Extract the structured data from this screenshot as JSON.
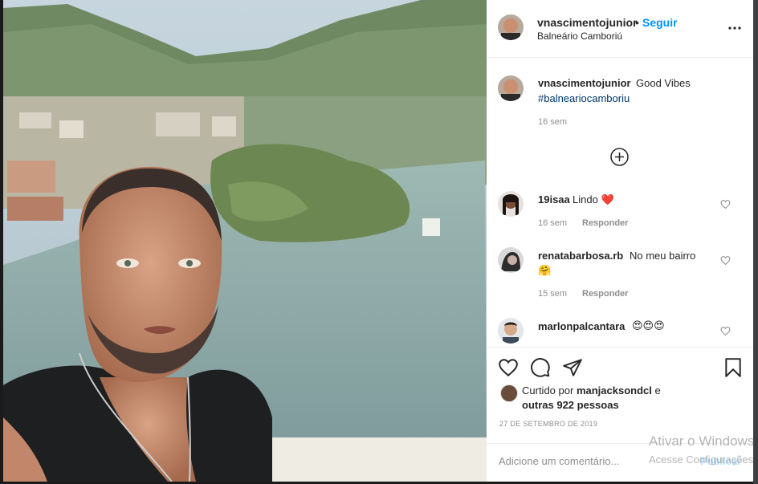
{
  "post": {
    "username": "vnascimentojunior",
    "dot": "•",
    "follow": "Seguir",
    "location": "Balneário Camboriú"
  },
  "caption": {
    "username": "vnascimentojunior",
    "text": "Good Vibes",
    "hashtag": "#balneariocamboriu",
    "time": "16 sem"
  },
  "comments": [
    {
      "username": "19isaa",
      "text": "Lindo",
      "emoji": "❤️",
      "time": "16 sem",
      "reply": "Responder"
    },
    {
      "username": "renatabarbosa.rb",
      "text": "No meu bairro",
      "emoji": "🤗",
      "time": "15 sem",
      "reply": "Responder"
    },
    {
      "username": "marlonpalcantara",
      "text": "",
      "emoji": "😍😍😍"
    }
  ],
  "likes": {
    "prefix": "Curtido por",
    "by": "manjacksondcl",
    "connector": "e",
    "others": "outras 922 pessoas"
  },
  "date": "27 DE SETEMBRO DE 2019",
  "add_comment": {
    "placeholder": "Adicione um comentário...",
    "publish": "Publicar"
  },
  "watermark": {
    "line1": "Ativar o Windows",
    "line2": "Acesse Configurações"
  },
  "colors": {
    "link": "#0095f6",
    "hashtag": "#00376b",
    "muted": "#8e8e8e",
    "heart": "#ed4956"
  },
  "icons": [
    "more-icon",
    "add-circle-icon",
    "heart-icon",
    "comment-icon",
    "share-icon",
    "bookmark-icon"
  ]
}
